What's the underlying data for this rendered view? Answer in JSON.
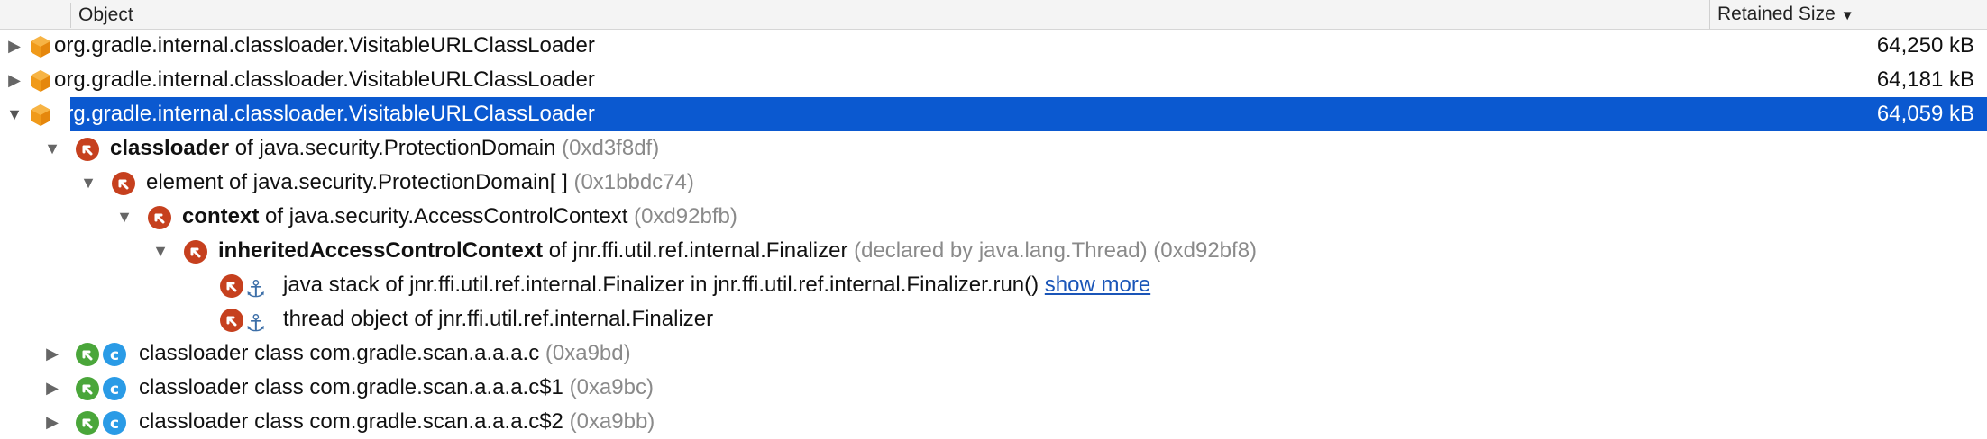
{
  "header": {
    "object_label": "Object",
    "retained_label": "Retained Size",
    "sort_icon": "sort-down-icon"
  },
  "rows": [
    {
      "text": "org.gradle.internal.classloader.VisitableURLClassLoader",
      "size": "64,250 kB",
      "expanded": false
    },
    {
      "text": "org.gradle.internal.classloader.VisitableURLClassLoader",
      "size": "64,181 kB",
      "expanded": false
    },
    {
      "text": "org.gradle.internal.classloader.VisitableURLClassLoader",
      "size": "64,059 kB",
      "expanded": true,
      "selected": true
    },
    {
      "field": "classloader",
      "of": " of java.security.ProtectionDomain ",
      "addr": "(0xd3f8df)"
    },
    {
      "field": "element",
      "of": " of java.security.ProtectionDomain[ ] ",
      "addr": "(0x1bbdc74)"
    },
    {
      "field": "context",
      "of": " of java.security.AccessControlContext ",
      "addr": "(0xd92bfb)"
    },
    {
      "field": "inheritedAccessControlContext",
      "of": " of jnr.ffi.util.ref.internal.Finalizer ",
      "declared": "(declared by java.lang.Thread)",
      "addr": "(0xd92bf8)"
    },
    {
      "text": "java stack of jnr.ffi.util.ref.internal.Finalizer in jnr.ffi.util.ref.internal.Finalizer.run()",
      "link": "show more"
    },
    {
      "text": "thread object of jnr.ffi.util.ref.internal.Finalizer"
    },
    {
      "text": "classloader class com.gradle.scan.a.a.a.c",
      "addr": "(0xa9bd)"
    },
    {
      "text": "classloader class com.gradle.scan.a.a.a.c$1",
      "addr": "(0xa9bc)"
    },
    {
      "text": "classloader class com.gradle.scan.a.a.a.c$2",
      "addr": "(0xa9bb)"
    }
  ],
  "icons": {
    "object": "object-cube-icon",
    "ref": "incoming-reference-icon",
    "gc_root": "gc-root-anchor-icon",
    "green_ref": "reference-green-icon",
    "class": "class-c-icon"
  },
  "colors": {
    "selection": "#0b59d0",
    "ref_badge": "#c6401e",
    "green_badge": "#4aa63a",
    "class_badge": "#2a9be6",
    "cube": "#f09a1a"
  }
}
